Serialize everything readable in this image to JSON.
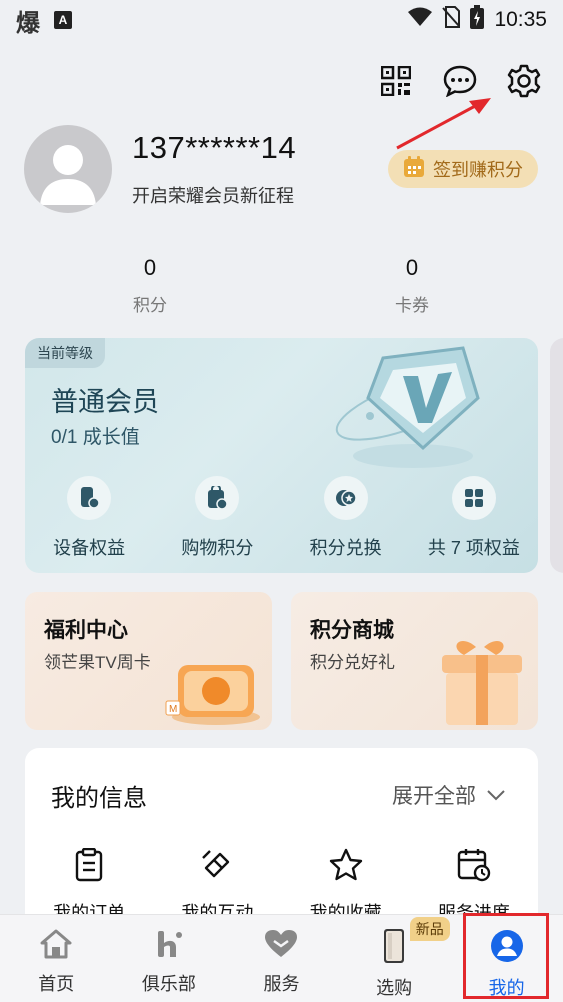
{
  "status_bar": {
    "time": "10:35",
    "app_badge": "A",
    "left_glyph": "爆"
  },
  "header_icons": [
    "qr-code-icon",
    "chat-icon",
    "gear-icon"
  ],
  "profile": {
    "phone": "137******14",
    "subtitle": "开启荣耀会员新征程"
  },
  "checkin_button": {
    "label": "签到赚积分"
  },
  "stats": [
    {
      "value": "0",
      "label": "积分"
    },
    {
      "value": "0",
      "label": "卡券"
    }
  ],
  "level_card": {
    "tag": "当前等级",
    "name": "普通会员",
    "growth": "0/1 成长值",
    "rights": [
      {
        "label": "设备权益",
        "icon": "device-rights-icon"
      },
      {
        "label": "购物积分",
        "icon": "shopping-points-icon"
      },
      {
        "label": "积分兑换",
        "icon": "points-exchange-icon"
      },
      {
        "label": "共 7 项权益",
        "icon": "grid-icon"
      }
    ]
  },
  "promos": [
    {
      "title": "福利中心",
      "subtitle": "领芒果TV周卡"
    },
    {
      "title": "积分商城",
      "subtitle": "积分兑好礼"
    }
  ],
  "my_info": {
    "title": "我的信息",
    "expand_label": "展开全部",
    "items": [
      {
        "label": "我的订单",
        "icon": "order-list-icon"
      },
      {
        "label": "我的互动",
        "icon": "interaction-icon"
      },
      {
        "label": "我的收藏",
        "icon": "star-icon"
      },
      {
        "label": "服务进度",
        "icon": "service-calendar-icon"
      }
    ]
  },
  "tabbar": {
    "tabs": [
      {
        "label": "首页",
        "icon": "home-icon"
      },
      {
        "label": "俱乐部",
        "icon": "club-icon"
      },
      {
        "label": "服务",
        "icon": "heart-icon"
      },
      {
        "label": "选购",
        "icon": "phone-product-icon",
        "badge": "新品"
      },
      {
        "label": "我的",
        "icon": "user-icon",
        "active": true
      }
    ]
  },
  "colors": {
    "accent": "#1766e8",
    "highlight": "#e2282c",
    "checkin_bg": "#f3dfb5",
    "checkin_text": "#a26a1a"
  }
}
